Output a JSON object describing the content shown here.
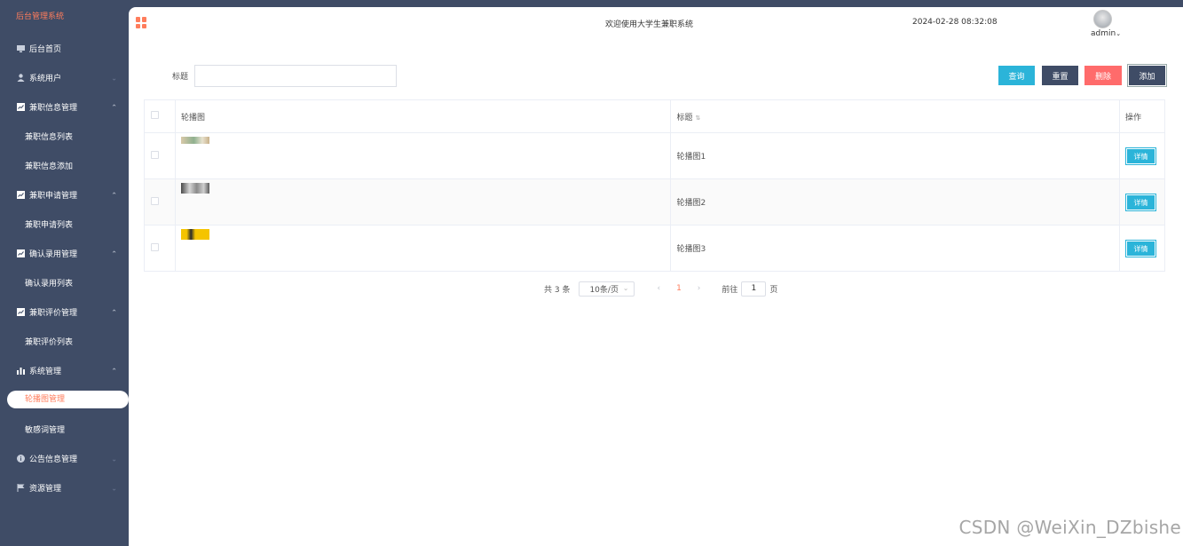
{
  "app": {
    "brand": "后台管理系统"
  },
  "sidebar": {
    "items": [
      {
        "label": "后台首页",
        "icon": "monitor-icon"
      },
      {
        "label": "系统用户",
        "icon": "user-icon"
      },
      {
        "label": "兼职信息管理",
        "icon": "chart-icon",
        "expanded": true,
        "children": [
          "兼职信息列表",
          "兼职信息添加"
        ]
      },
      {
        "label": "兼职申请管理",
        "icon": "chart-icon",
        "expanded": true,
        "children": [
          "兼职申请列表"
        ]
      },
      {
        "label": "确认录用管理",
        "icon": "chart-icon",
        "expanded": true,
        "children": [
          "确认录用列表"
        ]
      },
      {
        "label": "兼职评价管理",
        "icon": "chart-icon",
        "expanded": true,
        "children": [
          "兼职评价列表"
        ]
      },
      {
        "label": "系统管理",
        "icon": "bar-chart-icon",
        "expanded": true,
        "children": [
          "轮播图管理",
          "敏感词管理"
        ]
      },
      {
        "label": "公告信息管理",
        "icon": "info-icon"
      },
      {
        "label": "资源管理",
        "icon": "flag-icon"
      }
    ],
    "active": "轮播图管理"
  },
  "header": {
    "welcome": "欢迎使用大学生兼职系统",
    "datetime": "2024-02-28 08:32:08",
    "username": "admin"
  },
  "search": {
    "label": "标题",
    "value": ""
  },
  "toolbar": {
    "query": "查询",
    "reset": "重置",
    "delete": "删除",
    "add": "添加"
  },
  "table": {
    "columns": [
      "轮播图",
      "标题",
      "操作"
    ],
    "rows": [
      {
        "title": "轮播图1",
        "action": "详情"
      },
      {
        "title": "轮播图2",
        "action": "详情"
      },
      {
        "title": "轮播图3",
        "action": "详情"
      }
    ]
  },
  "pagination": {
    "total": "共 3 条",
    "page_size": "10条/页",
    "current_page": "1",
    "goto_label": "前往",
    "goto_value": "1",
    "page_unit": "页"
  },
  "watermark": "CSDN @WeiXin_DZbishe",
  "colors": {
    "sidebar": "#3f4c66",
    "accent": "#ff7d5c",
    "primary": "#2bb4d9",
    "danger": "#ff6b6b"
  }
}
